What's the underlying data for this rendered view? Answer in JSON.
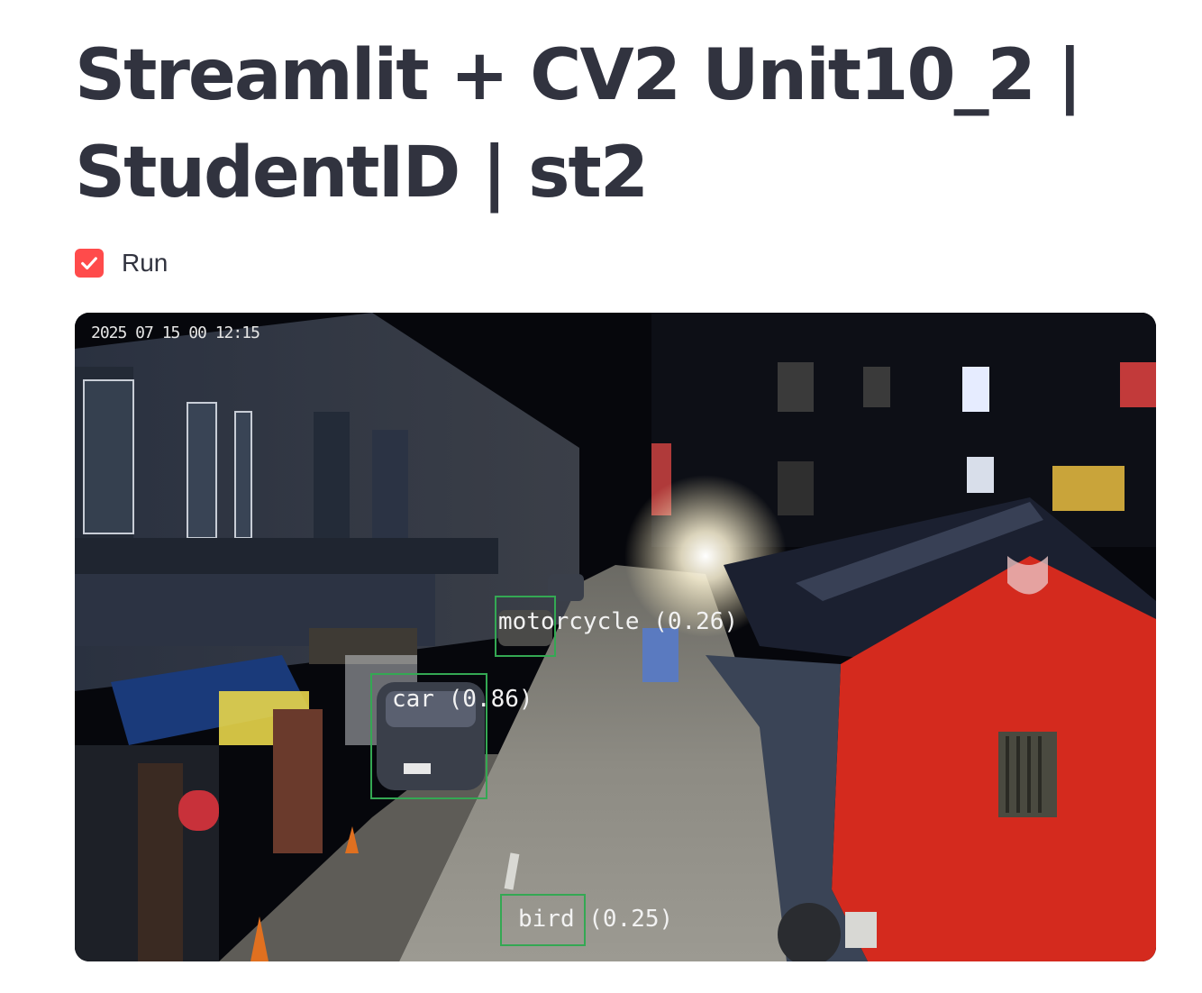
{
  "page": {
    "title": "Streamlit + CV2 Unit10_2 | StudentID | st2"
  },
  "controls": {
    "run_label": "Run",
    "run_checked": true
  },
  "video": {
    "timestamp": "2025 07 15 00 12:15",
    "detections": [
      {
        "label": "motorcycle (0.26)"
      },
      {
        "label": "car (0.86)"
      },
      {
        "label": "bird (0.25)"
      }
    ],
    "box_color": "#34a853"
  },
  "colors": {
    "accent": "#ff4b4b",
    "text": "#31333f"
  }
}
